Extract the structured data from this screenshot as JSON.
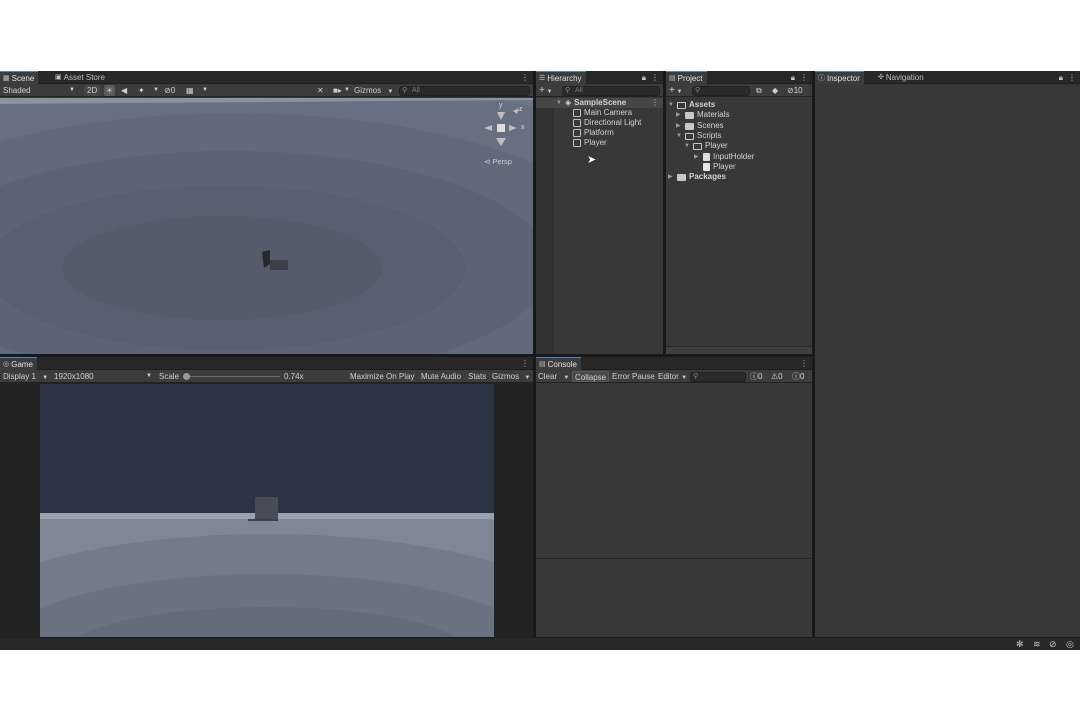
{
  "scene": {
    "tabs": [
      "Scene",
      "Asset Store"
    ],
    "shading_mode": "Shaded",
    "btn_2d": "2D",
    "hidden_count": "0",
    "gizmos_label": "Gizmos",
    "search_placeholder": "All",
    "gizmo_axis_y": "y",
    "gizmo_axis_x": "x",
    "gizmo_axis_z": "z",
    "projection_label": "Persp"
  },
  "hierarchy": {
    "tab": "Hierarchy",
    "search_placeholder": "All",
    "scene_name": "SampleScene",
    "items": [
      "Main Camera",
      "Directional Light",
      "Platform",
      "Player"
    ]
  },
  "project": {
    "tab": "Project",
    "hidden_count": "10",
    "tree": {
      "assets": "Assets",
      "materials": "Materials",
      "scenes": "Scenes",
      "scripts": "Scripts",
      "player_folder": "Player",
      "input_holder": "InputHolder",
      "player_script": "Player",
      "packages": "Packages"
    }
  },
  "inspector": {
    "tabs": [
      "Inspector",
      "Navigation"
    ]
  },
  "game": {
    "tab": "Game",
    "display": "Display 1",
    "resolution": "1920x1080",
    "scale_label": "Scale",
    "scale_value": "0.74x",
    "maximize": "Maximize On Play",
    "mute": "Mute Audio",
    "stats": "Stats",
    "gizmos": "Gizmos"
  },
  "console": {
    "tab": "Console",
    "clear": "Clear",
    "collapse": "Collapse",
    "error_pause": "Error Pause",
    "editor": "Editor",
    "log_count": "0",
    "warn_count": "0",
    "error_count": "0"
  },
  "colors": {
    "accent": "#4a86c8",
    "panel_bg": "#383838",
    "game_sky": "#2c3344"
  }
}
